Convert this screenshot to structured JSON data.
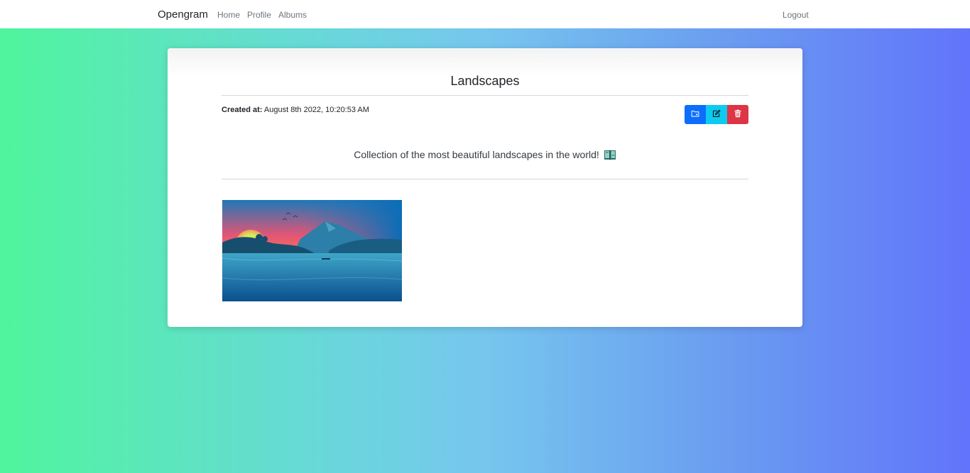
{
  "navbar": {
    "brand": "Opengram",
    "links": [
      "Home",
      "Profile",
      "Albums"
    ],
    "logout": "Logout"
  },
  "album": {
    "title": "Landscapes",
    "created_label": "Created at:",
    "created_value": "August 8th 2022, 10:20:53 AM",
    "description": "Collection of the most beautiful landscapes in the world!",
    "description_icon": "open-book-map-icon"
  },
  "actions": {
    "add_icon": "folder-plus-icon",
    "edit_icon": "pencil-square-icon",
    "delete_icon": "trash-icon"
  },
  "colors": {
    "primary": "#0d6efd",
    "info": "#0dcaf0",
    "danger": "#dc3545"
  },
  "photos": [
    {
      "icon": "landscape-photo"
    }
  ]
}
